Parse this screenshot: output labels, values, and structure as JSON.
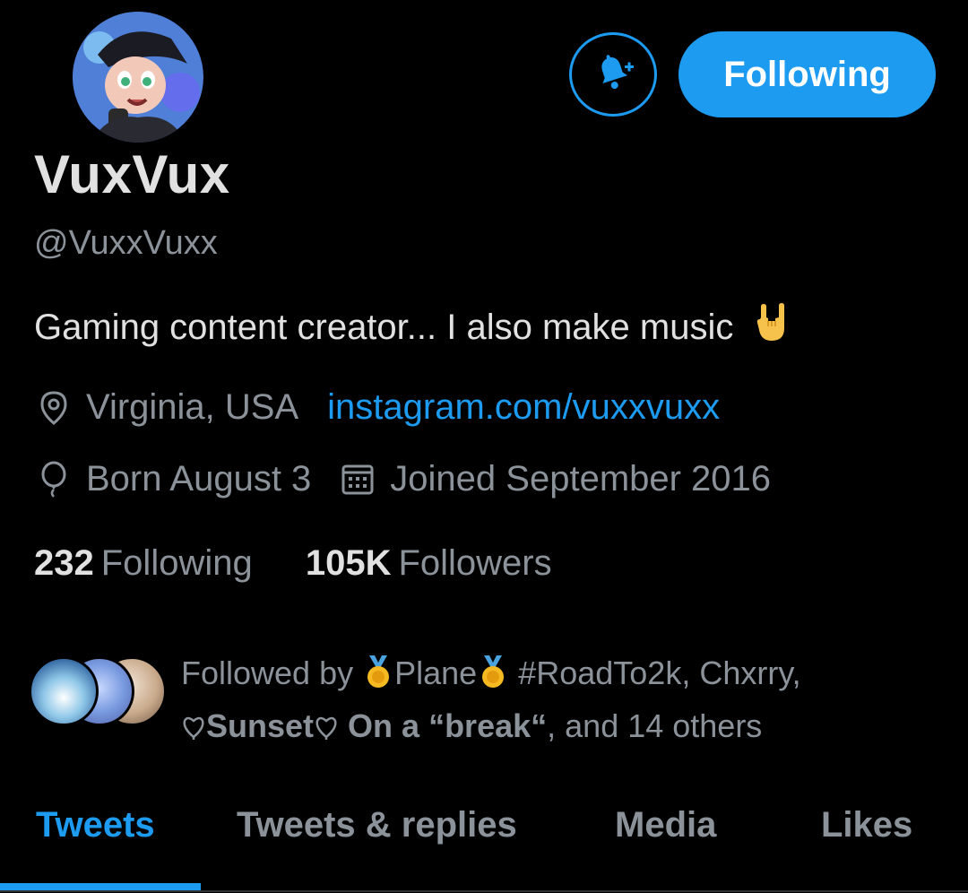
{
  "profile": {
    "display_name": "VuxVux",
    "handle": "@VuxxVuxx",
    "bio": "Gaming content creator... I also make music",
    "bio_emoji_icon": "rock-hand-icon",
    "location": "Virginia, USA",
    "website": "instagram.com/vuxxvuxx",
    "birthday": "Born August 3",
    "joined": "Joined September 2016"
  },
  "actions": {
    "notify_icon": "bell-plus-icon",
    "follow_label": "Following"
  },
  "stats": {
    "following_count": "232",
    "following_label": "Following",
    "followers_count": "105K",
    "followers_label": "Followers"
  },
  "followed_by": {
    "prefix": "Followed by",
    "user1": "Plane",
    "user1_suffix": "#RoadTo2k,",
    "user2": "Chxrry,",
    "user3_name": "Sunset",
    "user3_rest": "On a “break“",
    "tail": ", and 14 others"
  },
  "tabs": [
    {
      "label": "Tweets",
      "active": true
    },
    {
      "label": "Tweets & replies",
      "active": false
    },
    {
      "label": "Media",
      "active": false
    },
    {
      "label": "Likes",
      "active": false
    }
  ],
  "colors": {
    "accent": "#1d9bf0",
    "background": "#000000",
    "text_primary": "#e1e1e1",
    "text_secondary": "#8b9299"
  }
}
